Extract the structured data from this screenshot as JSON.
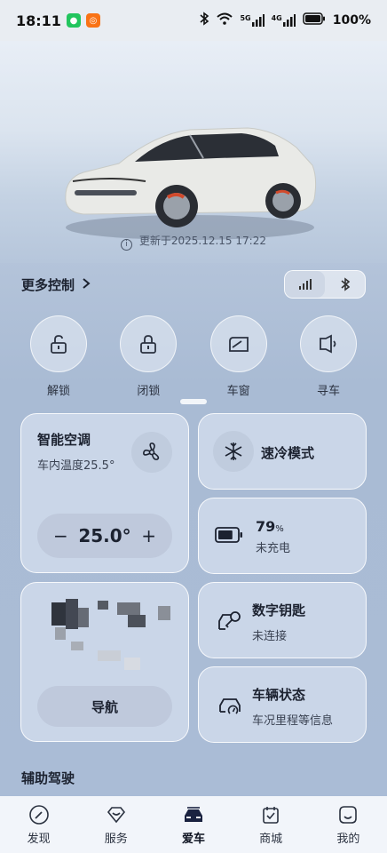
{
  "status_bar": {
    "time": "18:11",
    "network_5g": "5G",
    "network_4g": "4G",
    "battery": "100%"
  },
  "hero": {
    "update_text": "更新于2025.12.15 17:22"
  },
  "more_controls": {
    "label": "更多控制"
  },
  "quick_actions": [
    {
      "label": "解锁",
      "icon": "unlock-icon"
    },
    {
      "label": "闭锁",
      "icon": "lock-icon"
    },
    {
      "label": "车窗",
      "icon": "window-icon"
    },
    {
      "label": "寻车",
      "icon": "find-car-icon"
    }
  ],
  "climate": {
    "title": "智能空调",
    "subtitle": "车内温度25.5°",
    "temperature": "25.0°",
    "minus": "−",
    "plus": "+"
  },
  "fast_cool": {
    "title": "速冷模式"
  },
  "battery": {
    "percent": "79",
    "unit": "%",
    "status": "未充电",
    "level": 0.79
  },
  "navigation": {
    "button": "导航"
  },
  "digital_key": {
    "title": "数字钥匙",
    "status": "未连接"
  },
  "vehicle_status": {
    "title": "车辆状态",
    "subtitle": "车况里程等信息"
  },
  "assist_section": {
    "title": "辅助驾驶"
  },
  "tabs": [
    {
      "label": "发现",
      "icon": "compass-icon",
      "active": false
    },
    {
      "label": "服务",
      "icon": "service-icon",
      "active": false
    },
    {
      "label": "爱车",
      "icon": "car-icon",
      "active": true
    },
    {
      "label": "商城",
      "icon": "mall-icon",
      "active": false
    },
    {
      "label": "我的",
      "icon": "profile-icon",
      "active": false
    }
  ]
}
